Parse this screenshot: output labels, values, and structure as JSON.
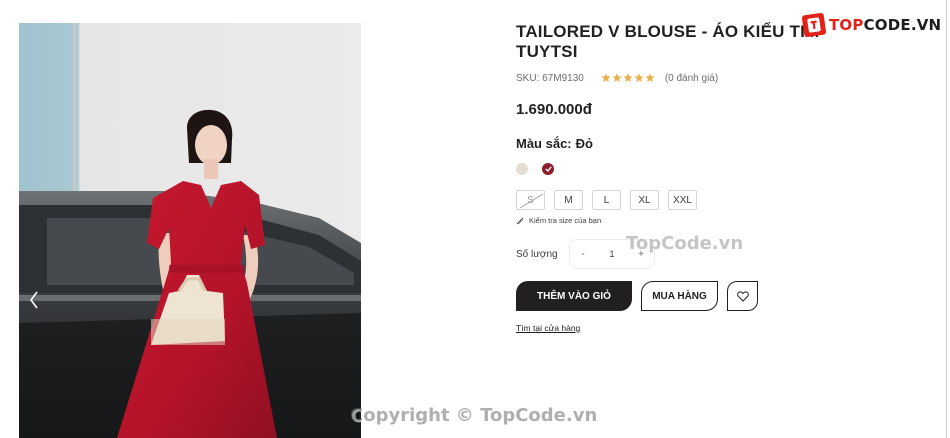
{
  "product": {
    "title": "TAILORED V BLOUSE - ÁO KIỂU TIM TUYTSI",
    "sku": "SKU: 67M9130",
    "rating_stars": 5,
    "reviews": "(0 đánh giá)",
    "price": "1.690.000đ",
    "color_label": "Màu sắc:",
    "color_selected": "Đỏ",
    "colors": [
      {
        "name": "beige",
        "hex": "#e3ddd2",
        "selected": false
      },
      {
        "name": "red",
        "hex": "#8e1d2c",
        "selected": true
      }
    ],
    "sizes": [
      {
        "label": "S",
        "available": false
      },
      {
        "label": "M",
        "available": true
      },
      {
        "label": "L",
        "available": true
      },
      {
        "label": "XL",
        "available": true
      },
      {
        "label": "XXL",
        "available": true
      }
    ],
    "size_guide": "Kiểm tra size của bạn",
    "quantity_label": "Số lượng",
    "quantity_minus": "-",
    "quantity_value": "1",
    "quantity_plus": "+",
    "add_to_cart": "THÊM VÀO GIỎ",
    "buy_now": "MUA HÀNG",
    "find_store": "Tìm tại cửa hàng"
  },
  "icons": {
    "gallery_prev": "chevron-left-icon",
    "wishlist": "heart-icon",
    "size_guide": "ruler-icon",
    "star": "star-icon",
    "check": "check-icon"
  },
  "colors": {
    "star": "#e8b14c",
    "accent_dark": "#221f20",
    "product_red": "#8e1d2c"
  },
  "watermarks": {
    "logo_prefix": "TOP",
    "logo_suffix": "CODE.VN",
    "middle": "TopCode.vn",
    "bottom": "Copyright © TopCode.vn"
  }
}
